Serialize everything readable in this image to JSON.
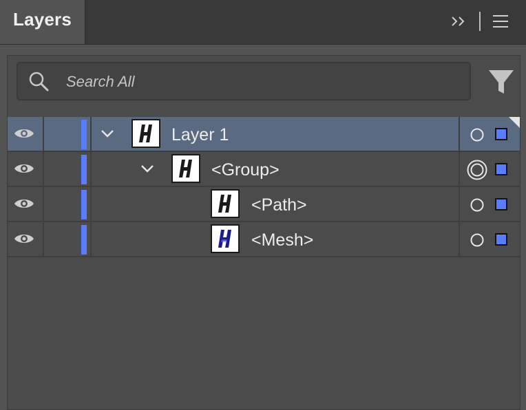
{
  "panel": {
    "tab_label": "Layers",
    "icons": {
      "collapse": "double-chevron-right-icon",
      "menu": "hamburger-menu-icon"
    }
  },
  "search": {
    "placeholder": "Search All",
    "value": ""
  },
  "filter": {
    "icon": "filter-funnel-icon"
  },
  "layers": [
    {
      "name": "Layer 1",
      "indent": 0,
      "expanded": true,
      "selected": true,
      "visible": true,
      "target": "circle",
      "color": "#5a7cff"
    },
    {
      "name": "<Group>",
      "indent": 1,
      "expanded": true,
      "selected": false,
      "visible": true,
      "target": "double-circle",
      "color": "#5a7cff"
    },
    {
      "name": "<Path>",
      "indent": 2,
      "expanded": false,
      "selected": false,
      "visible": true,
      "target": "circle",
      "color": "#5a7cff"
    },
    {
      "name": "<Mesh>",
      "indent": 2,
      "expanded": false,
      "selected": false,
      "visible": true,
      "target": "circle",
      "color": "#5a7cff"
    }
  ],
  "colors": {
    "accent": "#5a7cff",
    "selected_row": "#5a6a80",
    "panel_bg": "#4b4b4b"
  }
}
